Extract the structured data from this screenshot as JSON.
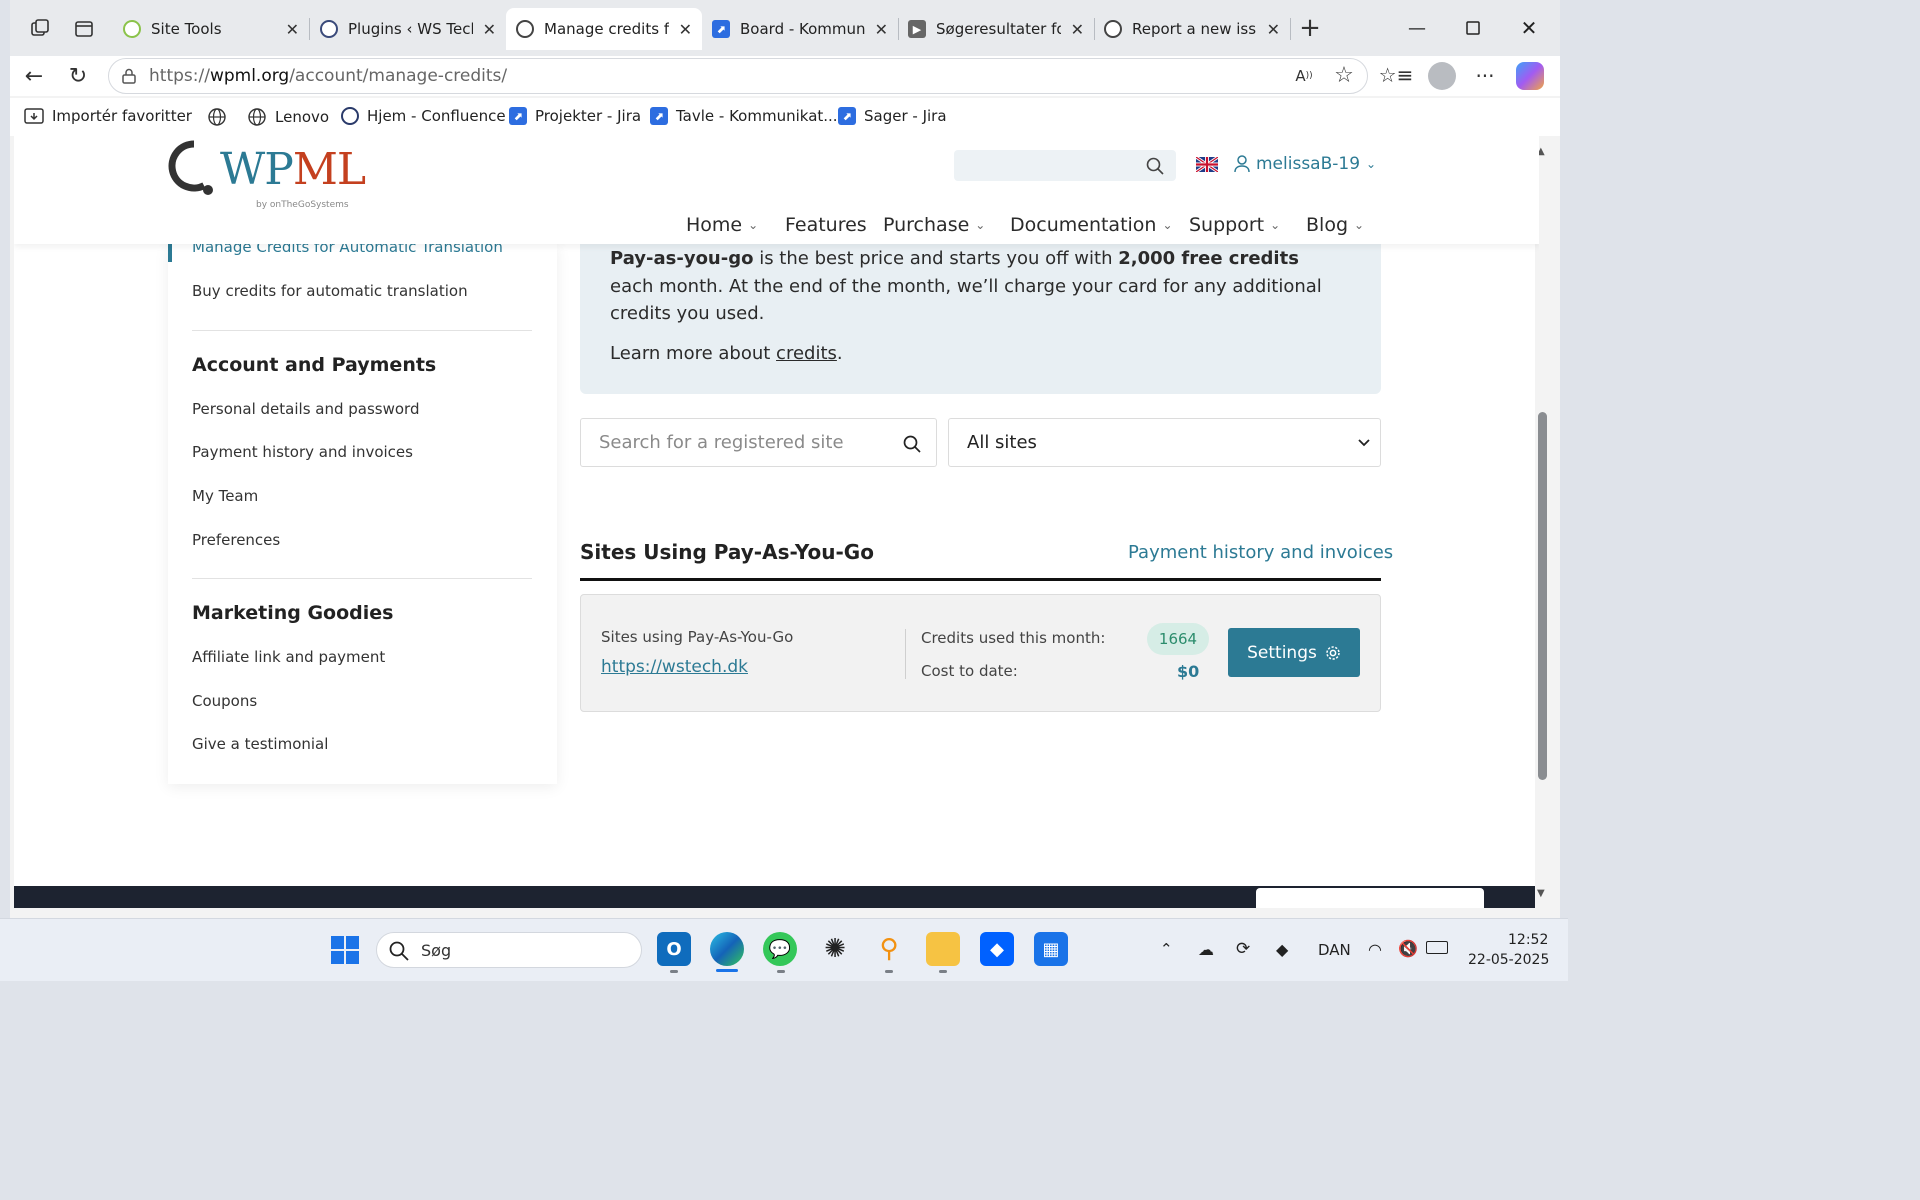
{
  "browser": {
    "tabs": [
      {
        "label": "Site Tools",
        "favicon": "site-tools-favicon"
      },
      {
        "label": "Plugins ‹ WS Techn",
        "favicon": "wordpress-favicon"
      },
      {
        "label": "Manage credits for",
        "favicon": "wpml-favicon",
        "active": true
      },
      {
        "label": "Board - Kommunik",
        "favicon": "jira-favicon"
      },
      {
        "label": "Søgeresultater for",
        "favicon": "video-favicon"
      },
      {
        "label": "Report a new issue",
        "favicon": "wpml-favicon"
      }
    ],
    "address": {
      "prefix": "https://",
      "domain": "wpml.org",
      "path": "/account/manage-credits/"
    },
    "bookmarks": [
      {
        "label": "Importér favoritter",
        "icon": "import-icon"
      },
      {
        "label": "",
        "icon": "globe-icon"
      },
      {
        "label": "Lenovo",
        "icon": "globe-icon"
      },
      {
        "label": "Hjem - Confluence",
        "icon": "confluence-icon"
      },
      {
        "label": "Projekter - Jira",
        "icon": "jira-icon"
      },
      {
        "label": "Tavle - Kommunikat...",
        "icon": "jira-icon"
      },
      {
        "label": "Sager - Jira",
        "icon": "jira-icon"
      }
    ]
  },
  "site": {
    "logo": {
      "text": "WPML",
      "byline": "by onTheGoSystems"
    },
    "user": "melissaB-19",
    "nav": [
      {
        "label": "Home",
        "dropdown": true
      },
      {
        "label": "Features",
        "dropdown": false
      },
      {
        "label": "Purchase",
        "dropdown": true
      },
      {
        "label": "Documentation",
        "dropdown": true
      },
      {
        "label": "Support",
        "dropdown": true
      },
      {
        "label": "Blog",
        "dropdown": true
      }
    ]
  },
  "sidebar": {
    "active_item": "Manage Credits for Automatic Translation",
    "buy_credits": "Buy credits for automatic translation",
    "account_heading": "Account and Payments",
    "account_items": [
      "Personal details and password",
      "Payment history and invoices",
      "My Team",
      "Preferences"
    ],
    "marketing_heading": "Marketing Goodies",
    "marketing_items": [
      "Affiliate link and payment",
      "Coupons",
      "Give a testimonial"
    ]
  },
  "info": {
    "bold1": "Pay-as-you-go",
    "text1": " is the best price and starts you off with ",
    "bold2": "2,000 free credits",
    "text2": " each month. At the end of the month, we’ll charge your card for any additional credits you used.",
    "learn_prefix": "Learn more about ",
    "learn_link": "credits",
    "learn_suffix": "."
  },
  "filters": {
    "search_placeholder": "Search for a registered site",
    "select_value": "All sites"
  },
  "payg": {
    "heading": "Sites Using Pay-As-You-Go",
    "history_link": "Payment history and invoices",
    "card": {
      "label": "Sites using Pay-As-You-Go",
      "site_url": "https://wstech.dk",
      "credits_label": "Credits used this month:",
      "credits_value": "1664",
      "cost_label": "Cost to date:",
      "cost_value": "$0",
      "settings_label": "Settings"
    }
  },
  "taskbar": {
    "search_placeholder": "Søg",
    "language": "DAN",
    "time": "12:52",
    "date": "22-05-2025"
  },
  "colors": {
    "accent_teal": "#2c7a94",
    "wpml_red": "#c4401f",
    "badge_bg": "#d6ede6",
    "badge_text": "#2b8c6c"
  }
}
